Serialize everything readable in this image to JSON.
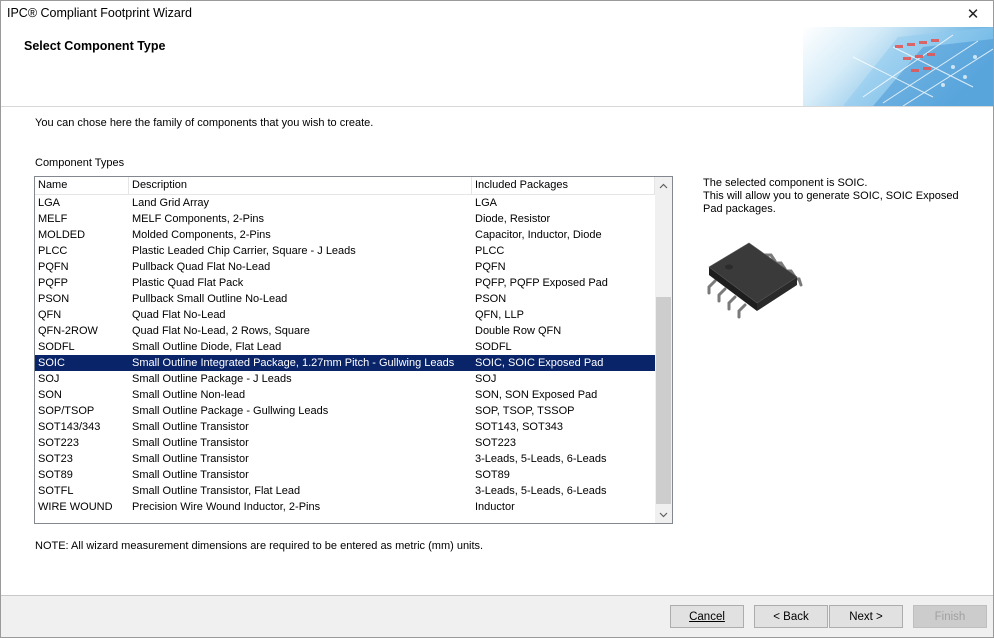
{
  "window": {
    "title": "IPC® Compliant Footprint Wizard"
  },
  "header": {
    "title": "Select Component Type"
  },
  "intro_text": "You can chose here the family of components that you wish to create.",
  "list_caption": "Component Types",
  "table": {
    "columns": [
      "Name",
      "Description",
      "Included Packages"
    ],
    "rows": [
      {
        "name": "LGA",
        "description": "Land Grid Array",
        "packages": "LGA"
      },
      {
        "name": "MELF",
        "description": "MELF Components, 2-Pins",
        "packages": "Diode, Resistor"
      },
      {
        "name": "MOLDED",
        "description": "Molded Components, 2-Pins",
        "packages": "Capacitor, Inductor, Diode"
      },
      {
        "name": "PLCC",
        "description": "Plastic Leaded Chip Carrier, Square - J Leads",
        "packages": "PLCC"
      },
      {
        "name": "PQFN",
        "description": "Pullback Quad Flat No-Lead",
        "packages": "PQFN"
      },
      {
        "name": "PQFP",
        "description": "Plastic Quad Flat Pack",
        "packages": "PQFP, PQFP Exposed Pad"
      },
      {
        "name": "PSON",
        "description": "Pullback Small Outline No-Lead",
        "packages": "PSON"
      },
      {
        "name": "QFN",
        "description": "Quad Flat No-Lead",
        "packages": "QFN, LLP"
      },
      {
        "name": "QFN-2ROW",
        "description": "Quad Flat No-Lead, 2 Rows, Square",
        "packages": "Double Row QFN"
      },
      {
        "name": "SODFL",
        "description": "Small Outline Diode, Flat Lead",
        "packages": "SODFL"
      },
      {
        "name": "SOIC",
        "description": "Small Outline Integrated Package, 1.27mm Pitch - Gullwing Leads",
        "packages": "SOIC, SOIC Exposed Pad",
        "selected": true
      },
      {
        "name": "SOJ",
        "description": "Small Outline Package - J Leads",
        "packages": "SOJ"
      },
      {
        "name": "SON",
        "description": "Small Outline Non-lead",
        "packages": "SON, SON Exposed Pad"
      },
      {
        "name": "SOP/TSOP",
        "description": "Small Outline Package - Gullwing Leads",
        "packages": "SOP, TSOP, TSSOP"
      },
      {
        "name": "SOT143/343",
        "description": "Small Outline Transistor",
        "packages": "SOT143, SOT343"
      },
      {
        "name": "SOT223",
        "description": "Small Outline Transistor",
        "packages": "SOT223"
      },
      {
        "name": "SOT23",
        "description": "Small Outline Transistor",
        "packages": "3-Leads, 5-Leads, 6-Leads"
      },
      {
        "name": "SOT89",
        "description": "Small Outline Transistor",
        "packages": "SOT89"
      },
      {
        "name": "SOTFL",
        "description": "Small Outline Transistor, Flat Lead",
        "packages": "3-Leads, 5-Leads, 6-Leads"
      },
      {
        "name": "WIRE WOUND",
        "description": "Precision Wire Wound Inductor, 2-Pins",
        "packages": "Inductor"
      }
    ]
  },
  "info": {
    "line1": "The selected component is SOIC.",
    "line2": "This will allow you to generate SOIC, SOIC Exposed Pad packages."
  },
  "note": "NOTE: All wizard measurement dimensions are required to be entered as metric (mm) units.",
  "buttons": {
    "cancel": "Cancel",
    "back": "< Back",
    "next": "Next >",
    "finish": "Finish"
  },
  "colors": {
    "selection": "#0a246a",
    "footer_bg": "#f0f0f0"
  }
}
